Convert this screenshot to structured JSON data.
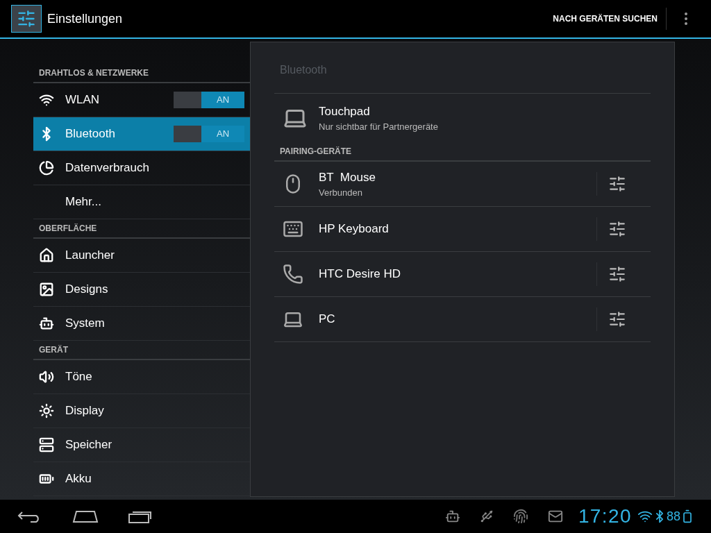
{
  "action_bar": {
    "title": "Einstellungen",
    "action": "NACH GERÄTEN SUCHEN"
  },
  "sidebar": {
    "sections": [
      {
        "header": "DRAHTLOS & NETZWERKE",
        "items": [
          {
            "label": "WLAN",
            "selected": false,
            "switch": {
              "on": true,
              "label": "AN"
            }
          },
          {
            "label": "Bluetooth",
            "selected": true,
            "switch": {
              "on": true,
              "label": "AN"
            }
          },
          {
            "label": "Datenverbrauch",
            "selected": false
          },
          {
            "label": "Mehr...",
            "selected": false
          }
        ]
      },
      {
        "header": "OBERFLÄCHE",
        "items": [
          {
            "label": "Launcher",
            "selected": false
          },
          {
            "label": "Designs",
            "selected": false
          },
          {
            "label": "System",
            "selected": false
          }
        ]
      },
      {
        "header": "GERÄT",
        "items": [
          {
            "label": "Töne",
            "selected": false
          },
          {
            "label": "Display",
            "selected": false
          },
          {
            "label": "Speicher",
            "selected": false
          },
          {
            "label": "Akku",
            "selected": false
          }
        ]
      }
    ]
  },
  "panel": {
    "title": "Bluetooth",
    "own_device": {
      "name": "Touchpad",
      "subtitle": "Nur sichtbar für Partnergeräte"
    },
    "paired_header": "PAIRING-GERÄTE",
    "paired": [
      {
        "name": "BT  Mouse",
        "status": "Verbunden"
      },
      {
        "name": "HP Keyboard"
      },
      {
        "name": "HTC Desire HD"
      },
      {
        "name": "PC"
      }
    ]
  },
  "status_bar": {
    "time": "17:20",
    "battery": "88"
  }
}
